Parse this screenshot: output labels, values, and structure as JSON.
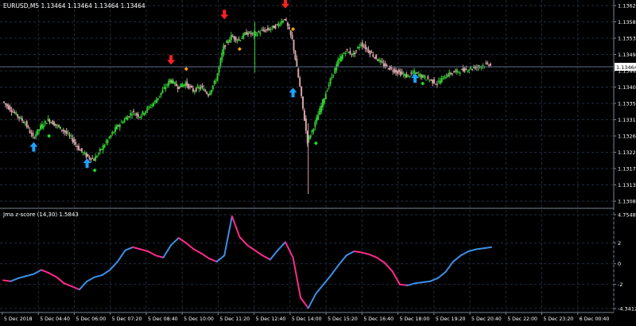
{
  "window": {
    "symbol_info": "EURUSD,M5  1.13464 1.13464 1.13464 1.13464",
    "indicator_label": "Jma z-score (14,30) 1.5843"
  },
  "main_axis": {
    "labels": [
      "1.13625",
      "1.13580",
      "1.13535",
      "1.13490",
      "1.13445",
      "1.13400",
      "1.13355",
      "1.13310",
      "1.13265",
      "1.13220",
      "1.13175",
      "1.13130",
      "1.13085"
    ],
    "current_price": "1.13464"
  },
  "indicator_axis": {
    "labels": [
      "4.7548",
      "2",
      "0",
      "-2",
      "-4.3412"
    ]
  },
  "time_axis": {
    "labels": [
      "5 Dec 2018",
      "5 Dec 04:40",
      "5 Dec 06:00",
      "5 Dec 07:20",
      "5 Dec 08:40",
      "5 Dec 10:00",
      "5 Dec 11:20",
      "5 Dec 12:40",
      "5 Dec 14:00",
      "5 Dec 15:20",
      "5 Dec 16:40",
      "5 Dec 18:00",
      "5 Dec 19:20",
      "5 Dec 20:40",
      "5 Dec 22:00",
      "5 Dec 23:20",
      "6 Dec 00:40"
    ]
  },
  "colors": {
    "background": "#000000",
    "grid": "#1f2c3c",
    "bull": "#32cd32",
    "bear": "#d4a3a8",
    "up_arrow": "#1ea3ff",
    "down_arrow": "#ff2020",
    "green_diamond": "#22dd22",
    "orange_diamond": "#ffa500",
    "zscore_up": "#3b8fe8",
    "zscore_down": "#ff2b8a",
    "price_line": "#5a6a8a"
  },
  "markers": {
    "up_arrows": [
      {
        "x": 4,
        "p": 1.13235
      },
      {
        "x": 11,
        "p": 1.1319
      },
      {
        "x": 38,
        "p": 1.13385
      },
      {
        "x": 54,
        "p": 1.13425
      }
    ],
    "down_arrows": [
      {
        "x": 22,
        "p": 1.13475
      },
      {
        "x": 29,
        "p": 1.136
      },
      {
        "x": 37,
        "p": 1.1363
      }
    ],
    "green_diamonds": [
      {
        "x": 6,
        "p": 1.13265
      },
      {
        "x": 12,
        "p": 1.1317
      },
      {
        "x": 41,
        "p": 1.13245
      },
      {
        "x": 55,
        "p": 1.1341
      }
    ],
    "orange_diamonds": [
      {
        "x": 24,
        "p": 1.1345
      },
      {
        "x": 31,
        "p": 1.13505
      },
      {
        "x": 38,
        "p": 1.1356
      }
    ]
  },
  "chart_data": [
    {
      "type": "line",
      "title": "EURUSD,M5",
      "series": [
        {
          "name": "EURUSD close",
          "x": [
            0,
            1,
            2,
            3,
            4,
            5,
            6,
            7,
            8,
            9,
            10,
            11,
            12,
            13,
            14,
            15,
            16,
            17,
            18,
            19,
            20,
            21,
            22,
            23,
            24,
            25,
            26,
            27,
            28,
            29,
            30,
            31,
            32,
            33,
            34,
            35,
            36,
            37,
            38,
            39,
            40,
            41,
            42,
            43,
            44,
            45,
            46,
            47,
            48,
            49,
            50,
            51,
            52,
            53,
            54,
            55,
            56,
            57,
            58,
            59,
            60,
            61,
            62,
            63,
            64
          ],
          "values": [
            1.1336,
            1.1334,
            1.1332,
            1.133,
            1.1326,
            1.1329,
            1.1331,
            1.13295,
            1.1328,
            1.1326,
            1.1323,
            1.1321,
            1.132,
            1.1323,
            1.1326,
            1.1329,
            1.1331,
            1.1333,
            1.1332,
            1.1334,
            1.1336,
            1.1339,
            1.1342,
            1.134,
            1.1341,
            1.1339,
            1.134,
            1.1338,
            1.1342,
            1.1351,
            1.1354,
            1.1353,
            1.1355,
            1.13545,
            1.13555,
            1.1356,
            1.1357,
            1.1359,
            1.1353,
            1.134,
            1.1325,
            1.133,
            1.1336,
            1.1342,
            1.1347,
            1.135,
            1.1349,
            1.1352,
            1.135,
            1.1348,
            1.1346,
            1.1345,
            1.1344,
            1.1343,
            1.1344,
            1.1343,
            1.1342,
            1.1341,
            1.1343,
            1.1344,
            1.13445,
            1.1345,
            1.13455,
            1.1346,
            1.13464
          ]
        }
      ],
      "x_tick_labels": [
        "5 Dec 2018",
        "5 Dec 04:40",
        "5 Dec 06:00",
        "5 Dec 07:20",
        "5 Dec 08:40",
        "5 Dec 10:00",
        "5 Dec 11:20",
        "5 Dec 12:40",
        "5 Dec 14:00",
        "5 Dec 15:20",
        "5 Dec 16:40",
        "5 Dec 18:00",
        "5 Dec 19:20",
        "5 Dec 20:40",
        "5 Dec 22:00",
        "5 Dec 23:20",
        "6 Dec 00:40"
      ],
      "ylim": [
        1.13085,
        1.13625
      ],
      "grid": true
    },
    {
      "type": "line",
      "title": "Jma z-score (14,30) 1.5843",
      "series": [
        {
          "name": "Jma z-score",
          "x": [
            0,
            1,
            2,
            3,
            4,
            5,
            6,
            7,
            8,
            9,
            10,
            11,
            12,
            13,
            14,
            15,
            16,
            17,
            18,
            19,
            20,
            21,
            22,
            23,
            24,
            25,
            26,
            27,
            28,
            29,
            30,
            31,
            32,
            33,
            34,
            35,
            36,
            37,
            38,
            39,
            40,
            41,
            42,
            43,
            44,
            45,
            46,
            47,
            48,
            49,
            50,
            51,
            52,
            53,
            54,
            55,
            56,
            57,
            58,
            59,
            60,
            61,
            62,
            63,
            64
          ],
          "values": [
            -1.6,
            -1.7,
            -1.4,
            -1.2,
            -1.0,
            -0.6,
            -0.9,
            -1.3,
            -1.9,
            -2.2,
            -2.5,
            -1.7,
            -1.3,
            -1.1,
            -0.6,
            0.2,
            1.3,
            1.6,
            1.4,
            1.2,
            0.8,
            0.6,
            1.8,
            2.5,
            2.0,
            1.4,
            1.0,
            0.5,
            0.2,
            0.8,
            4.6,
            2.6,
            1.8,
            1.3,
            0.8,
            0.4,
            1.3,
            2.1,
            0.6,
            -3.3,
            -4.3,
            -2.9,
            -2.0,
            -1.1,
            -0.1,
            0.8,
            1.2,
            1.1,
            0.9,
            0.6,
            0.1,
            -0.7,
            -2.0,
            -2.1,
            -1.9,
            -1.8,
            -1.7,
            -1.4,
            -0.8,
            0.2,
            0.8,
            1.2,
            1.4,
            1.5,
            1.6
          ]
        }
      ],
      "ylim": [
        -4.3412,
        4.7548
      ],
      "grid": true
    }
  ]
}
